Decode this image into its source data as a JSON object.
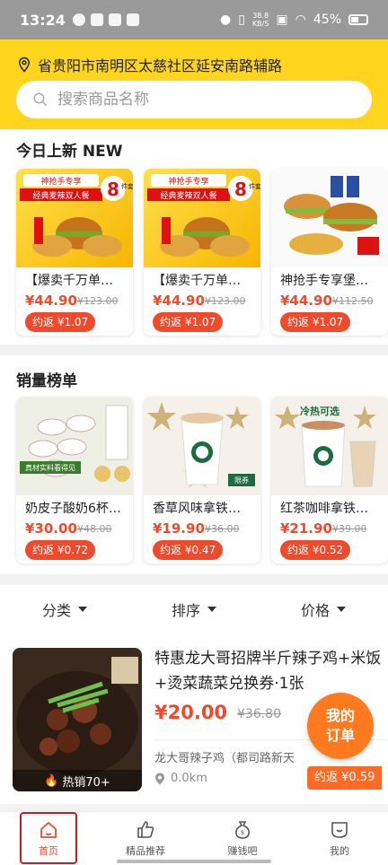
{
  "status": {
    "time": "13:24",
    "net": [
      "38.8",
      "KB/S"
    ],
    "battery": "45%"
  },
  "header": {
    "location": "省贵阳市南明区太慈社区延安南路辅路",
    "search_placeholder": "搜索商品名称"
  },
  "today_new": {
    "title": "今日上新 NEW",
    "items": [
      {
        "name": "【爆卖千万单…",
        "price": "¥44.90",
        "old": "¥123.00",
        "rebate": "约返 ¥1.07"
      },
      {
        "name": "【爆卖千万单…",
        "price": "¥44.90",
        "old": "¥123.00",
        "rebate": "约返 ¥1.07"
      },
      {
        "name": "神抢手专享堡…",
        "price": "¥44.90",
        "old": "¥112.50",
        "rebate": "约返 ¥1.07"
      }
    ],
    "banner_text": [
      "神抢手专享",
      "经典麦辣双人餐",
      "8",
      "件套"
    ]
  },
  "sales": {
    "title": "销量榜单",
    "items": [
      {
        "name": "奶皮子酸奶6杯…",
        "price": "¥30.00",
        "old": "¥48.00",
        "rebate": "约返 ¥0.72"
      },
      {
        "name": "香草风味拿铁…",
        "price": "¥19.90",
        "old": "¥36.00",
        "rebate": "约返 ¥0.47"
      },
      {
        "name": "红茶咖啡拿铁…",
        "price": "¥21.90",
        "old": "¥39.00",
        "rebate": "约返 ¥0.52"
      }
    ],
    "tags": [
      "真材实料看得见",
      "限券",
      "冷热可选"
    ]
  },
  "filters": [
    "分类",
    "排序",
    "价格"
  ],
  "product": {
    "title": "特惠龙大哥招牌半斤辣子鸡+米饭+烫菜蔬菜兑换券·1张",
    "price": "¥20.00",
    "old": "¥36.80",
    "shop": "龙大哥辣子鸡（都司路新天",
    "distance": "0.0km",
    "rebate": "约返 ¥0.59",
    "hot": "热销70+"
  },
  "my_order": [
    "我的",
    "订单"
  ],
  "tabs": [
    "首页",
    "精品推荐",
    "赚钱吧",
    "我的"
  ],
  "colors": {
    "brand_yellow": "#ffd51d",
    "accent_red": "#f04a2c",
    "orange": "#ff7a1f"
  }
}
